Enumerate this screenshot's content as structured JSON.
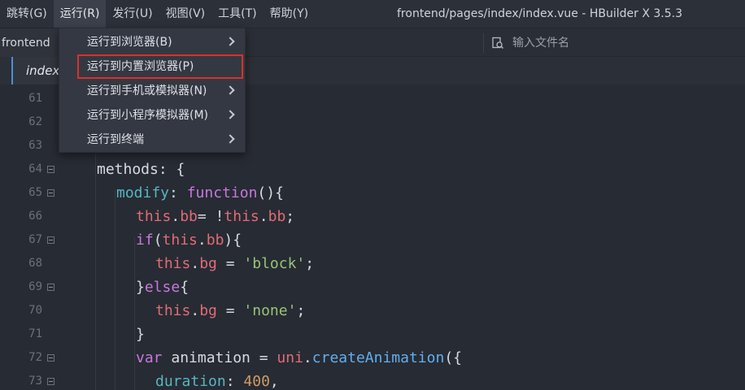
{
  "menubar": {
    "items": [
      {
        "label": "跳转(G)"
      },
      {
        "label": "运行(R)"
      },
      {
        "label": "发行(U)"
      },
      {
        "label": "视图(V)"
      },
      {
        "label": "工具(T)"
      },
      {
        "label": "帮助(Y)"
      }
    ],
    "window_title": "frontend/pages/index/index.vue - HBuilder X 3.5.3"
  },
  "toolbar": {
    "project_name": "frontend",
    "file_search_placeholder": "输入文件名",
    "file_search_icon": "file-search-icon"
  },
  "tabs": [
    {
      "label": "index."
    }
  ],
  "run_menu": {
    "items": [
      {
        "label": "运行到浏览器(B)",
        "has_submenu": true
      },
      {
        "label": "运行到内置浏览器(P)",
        "has_submenu": false
      },
      {
        "label": "运行到手机或模拟器(N)",
        "has_submenu": true
      },
      {
        "label": "运行到小程序模拟器(M)",
        "has_submenu": true
      },
      {
        "label": "运行到终端",
        "has_submenu": true
      }
    ],
    "highlight_color": "#d9312b"
  },
  "editor": {
    "lines": [
      {
        "no": "61",
        "fold": false,
        "tokens": []
      },
      {
        "no": "62",
        "fold": false,
        "tokens": []
      },
      {
        "no": "63",
        "fold": false,
        "tokens": []
      },
      {
        "no": "64",
        "fold": true,
        "tokens": [
          {
            "t": "methods: {",
            "c": "plain"
          }
        ]
      },
      {
        "no": "65",
        "fold": true,
        "tokens": [
          {
            "t": "modify",
            "c": "attr"
          },
          {
            "t": ": ",
            "c": "plain"
          },
          {
            "t": "function",
            "c": "kw"
          },
          {
            "t": "(){",
            "c": "plain"
          }
        ]
      },
      {
        "no": "66",
        "fold": false,
        "tokens": [
          {
            "t": "this",
            "c": "prop"
          },
          {
            "t": ".",
            "c": "plain"
          },
          {
            "t": "bb",
            "c": "prop"
          },
          {
            "t": "= !",
            "c": "plain"
          },
          {
            "t": "this",
            "c": "prop"
          },
          {
            "t": ".",
            "c": "plain"
          },
          {
            "t": "bb",
            "c": "prop"
          },
          {
            "t": ";",
            "c": "plain"
          }
        ]
      },
      {
        "no": "67",
        "fold": true,
        "tokens": [
          {
            "t": "if",
            "c": "kw"
          },
          {
            "t": "(",
            "c": "plain"
          },
          {
            "t": "this",
            "c": "prop"
          },
          {
            "t": ".",
            "c": "plain"
          },
          {
            "t": "bb",
            "c": "prop"
          },
          {
            "t": "){",
            "c": "plain"
          }
        ]
      },
      {
        "no": "68",
        "fold": false,
        "tokens": [
          {
            "t": "this",
            "c": "prop"
          },
          {
            "t": ".",
            "c": "plain"
          },
          {
            "t": "bg",
            "c": "prop"
          },
          {
            "t": " = ",
            "c": "plain"
          },
          {
            "t": "'block'",
            "c": "str"
          },
          {
            "t": ";",
            "c": "plain"
          }
        ]
      },
      {
        "no": "69",
        "fold": true,
        "tokens": [
          {
            "t": "}",
            "c": "plain"
          },
          {
            "t": "else",
            "c": "kw"
          },
          {
            "t": "{",
            "c": "plain"
          }
        ]
      },
      {
        "no": "70",
        "fold": false,
        "tokens": [
          {
            "t": "this",
            "c": "prop"
          },
          {
            "t": ".",
            "c": "plain"
          },
          {
            "t": "bg",
            "c": "prop"
          },
          {
            "t": " = ",
            "c": "plain"
          },
          {
            "t": "'none'",
            "c": "str"
          },
          {
            "t": ";",
            "c": "plain"
          }
        ]
      },
      {
        "no": "71",
        "fold": false,
        "tokens": [
          {
            "t": "}",
            "c": "plain"
          }
        ]
      },
      {
        "no": "72",
        "fold": true,
        "tokens": [
          {
            "t": "var",
            "c": "kw"
          },
          {
            "t": " animation = ",
            "c": "plain"
          },
          {
            "t": "uni",
            "c": "prop"
          },
          {
            "t": ".",
            "c": "plain"
          },
          {
            "t": "createAnimation",
            "c": "fn"
          },
          {
            "t": "({",
            "c": "plain"
          }
        ]
      },
      {
        "no": "73",
        "fold": true,
        "tokens": [
          {
            "t": "duration",
            "c": "attr"
          },
          {
            "t": ": ",
            "c": "plain"
          },
          {
            "t": "400",
            "c": "num"
          },
          {
            "t": ",",
            "c": "plain"
          }
        ]
      }
    ]
  }
}
